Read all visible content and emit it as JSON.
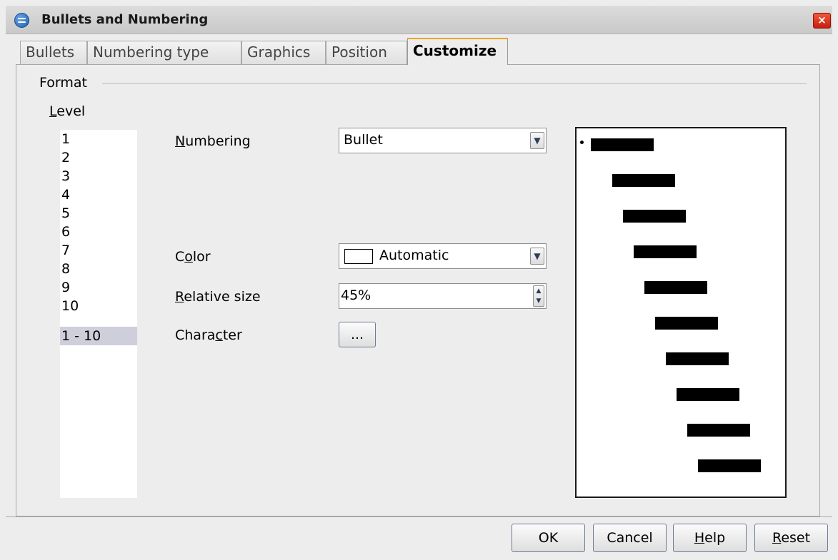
{
  "window": {
    "title": "Bullets and Numbering",
    "close_glyph": "×"
  },
  "tabs": [
    {
      "label": "Bullets"
    },
    {
      "label": "Numbering type"
    },
    {
      "label": "Graphics"
    },
    {
      "label": "Position"
    },
    {
      "label": "Customize",
      "active": true
    }
  ],
  "format": {
    "section_label": "Format",
    "level": {
      "label": "Level",
      "items": [
        "1",
        "2",
        "3",
        "4",
        "5",
        "6",
        "7",
        "8",
        "9",
        "10",
        "1 - 10"
      ],
      "selected": "1 - 10"
    },
    "numbering": {
      "label": "Numbering",
      "value": "Bullet"
    },
    "color": {
      "label": "Color",
      "value": "Automatic",
      "swatch": "#ffffff"
    },
    "relative_size": {
      "label": "Relative size",
      "value": "45%"
    },
    "character": {
      "label": "Character",
      "button_label": "..."
    }
  },
  "preview": {
    "levels": 10
  },
  "buttons": {
    "ok": "OK",
    "cancel": "Cancel",
    "help": "Help",
    "reset": "Reset"
  },
  "icons": {
    "app": "app-logo-icon",
    "close": "close-icon",
    "dropdown": "chevron-down-icon",
    "spin": "spin-arrows-icon"
  }
}
